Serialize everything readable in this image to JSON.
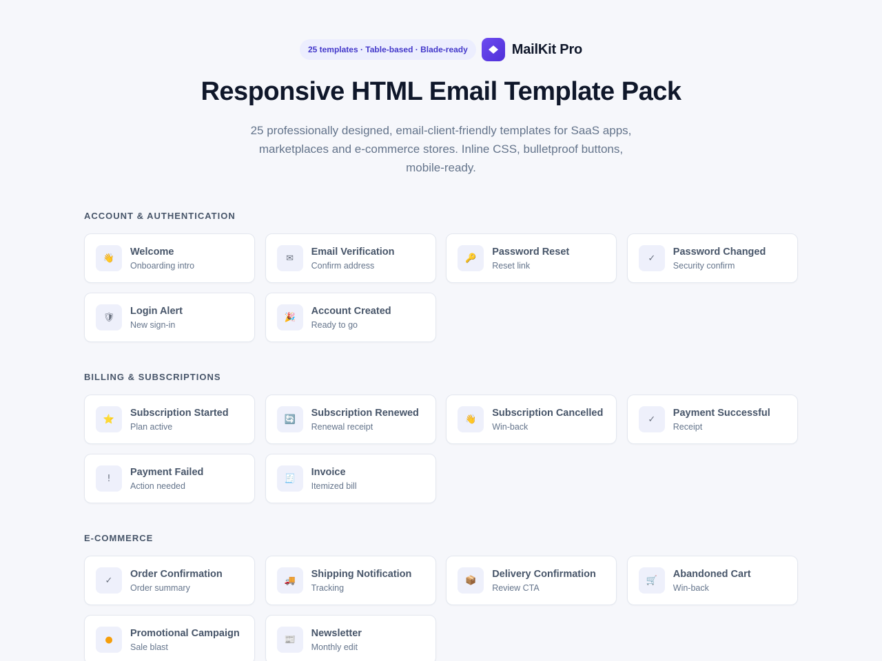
{
  "header": {
    "badge": "25 templates · Table-based · Blade-ready",
    "brand_name": "MailKit Pro",
    "brand_icon": "diamond-logo-icon",
    "brand_color": "#5b3be6"
  },
  "hero": {
    "title": "Responsive HTML Email Template Pack",
    "subtitle": "25 professionally designed, email-client-friendly templates for SaaS apps, marketplaces and e-commerce stores. Inline CSS, bulletproof buttons, mobile-ready."
  },
  "sections": [
    {
      "title": "ACCOUNT & AUTHENTICATION",
      "items": [
        {
          "title": "Welcome",
          "subtitle": "Onboarding intro",
          "icon": "waving-hand-icon",
          "glyph": "👋"
        },
        {
          "title": "Email Verification",
          "subtitle": "Confirm address",
          "icon": "envelope-icon",
          "glyph": "✉"
        },
        {
          "title": "Password Reset",
          "subtitle": "Reset link",
          "icon": "key-icon",
          "glyph": "🔑"
        },
        {
          "title": "Password Changed",
          "subtitle": "Security confirm",
          "icon": "checkmark-icon",
          "glyph": "✓"
        },
        {
          "title": "Login Alert",
          "subtitle": "New sign-in",
          "icon": "shield-icon",
          "glyph": "🛡"
        },
        {
          "title": "Account Created",
          "subtitle": "Ready to go",
          "icon": "party-popper-icon",
          "glyph": "🎉"
        }
      ]
    },
    {
      "title": "BILLING & SUBSCRIPTIONS",
      "items": [
        {
          "title": "Subscription Started",
          "subtitle": "Plan active",
          "icon": "star-icon",
          "glyph": "⭐"
        },
        {
          "title": "Subscription Renewed",
          "subtitle": "Renewal receipt",
          "icon": "refresh-icon",
          "glyph": "🔄"
        },
        {
          "title": "Subscription Cancelled",
          "subtitle": "Win-back",
          "icon": "waving-hand-icon",
          "glyph": "👋"
        },
        {
          "title": "Payment Successful",
          "subtitle": "Receipt",
          "icon": "checkmark-icon",
          "glyph": "✓"
        },
        {
          "title": "Payment Failed",
          "subtitle": "Action needed",
          "icon": "exclamation-icon",
          "glyph": "!"
        },
        {
          "title": "Invoice",
          "subtitle": "Itemized bill",
          "icon": "receipt-icon",
          "glyph": "🧾"
        }
      ]
    },
    {
      "title": "E-COMMERCE",
      "items": [
        {
          "title": "Order Confirmation",
          "subtitle": "Order summary",
          "icon": "checkmark-icon",
          "glyph": "✓"
        },
        {
          "title": "Shipping Notification",
          "subtitle": "Tracking",
          "icon": "truck-icon",
          "glyph": "🚚"
        },
        {
          "title": "Delivery Confirmation",
          "subtitle": "Review CTA",
          "icon": "package-icon",
          "glyph": "📦"
        },
        {
          "title": "Abandoned Cart",
          "subtitle": "Win-back",
          "icon": "shopping-cart-icon",
          "glyph": "🛒"
        },
        {
          "title": "Promotional Campaign",
          "subtitle": "Sale blast",
          "icon": "sale-badge-icon",
          "glyph": "●"
        },
        {
          "title": "Newsletter",
          "subtitle": "Monthly edit",
          "icon": "newspaper-icon",
          "glyph": "📰"
        }
      ]
    }
  ]
}
